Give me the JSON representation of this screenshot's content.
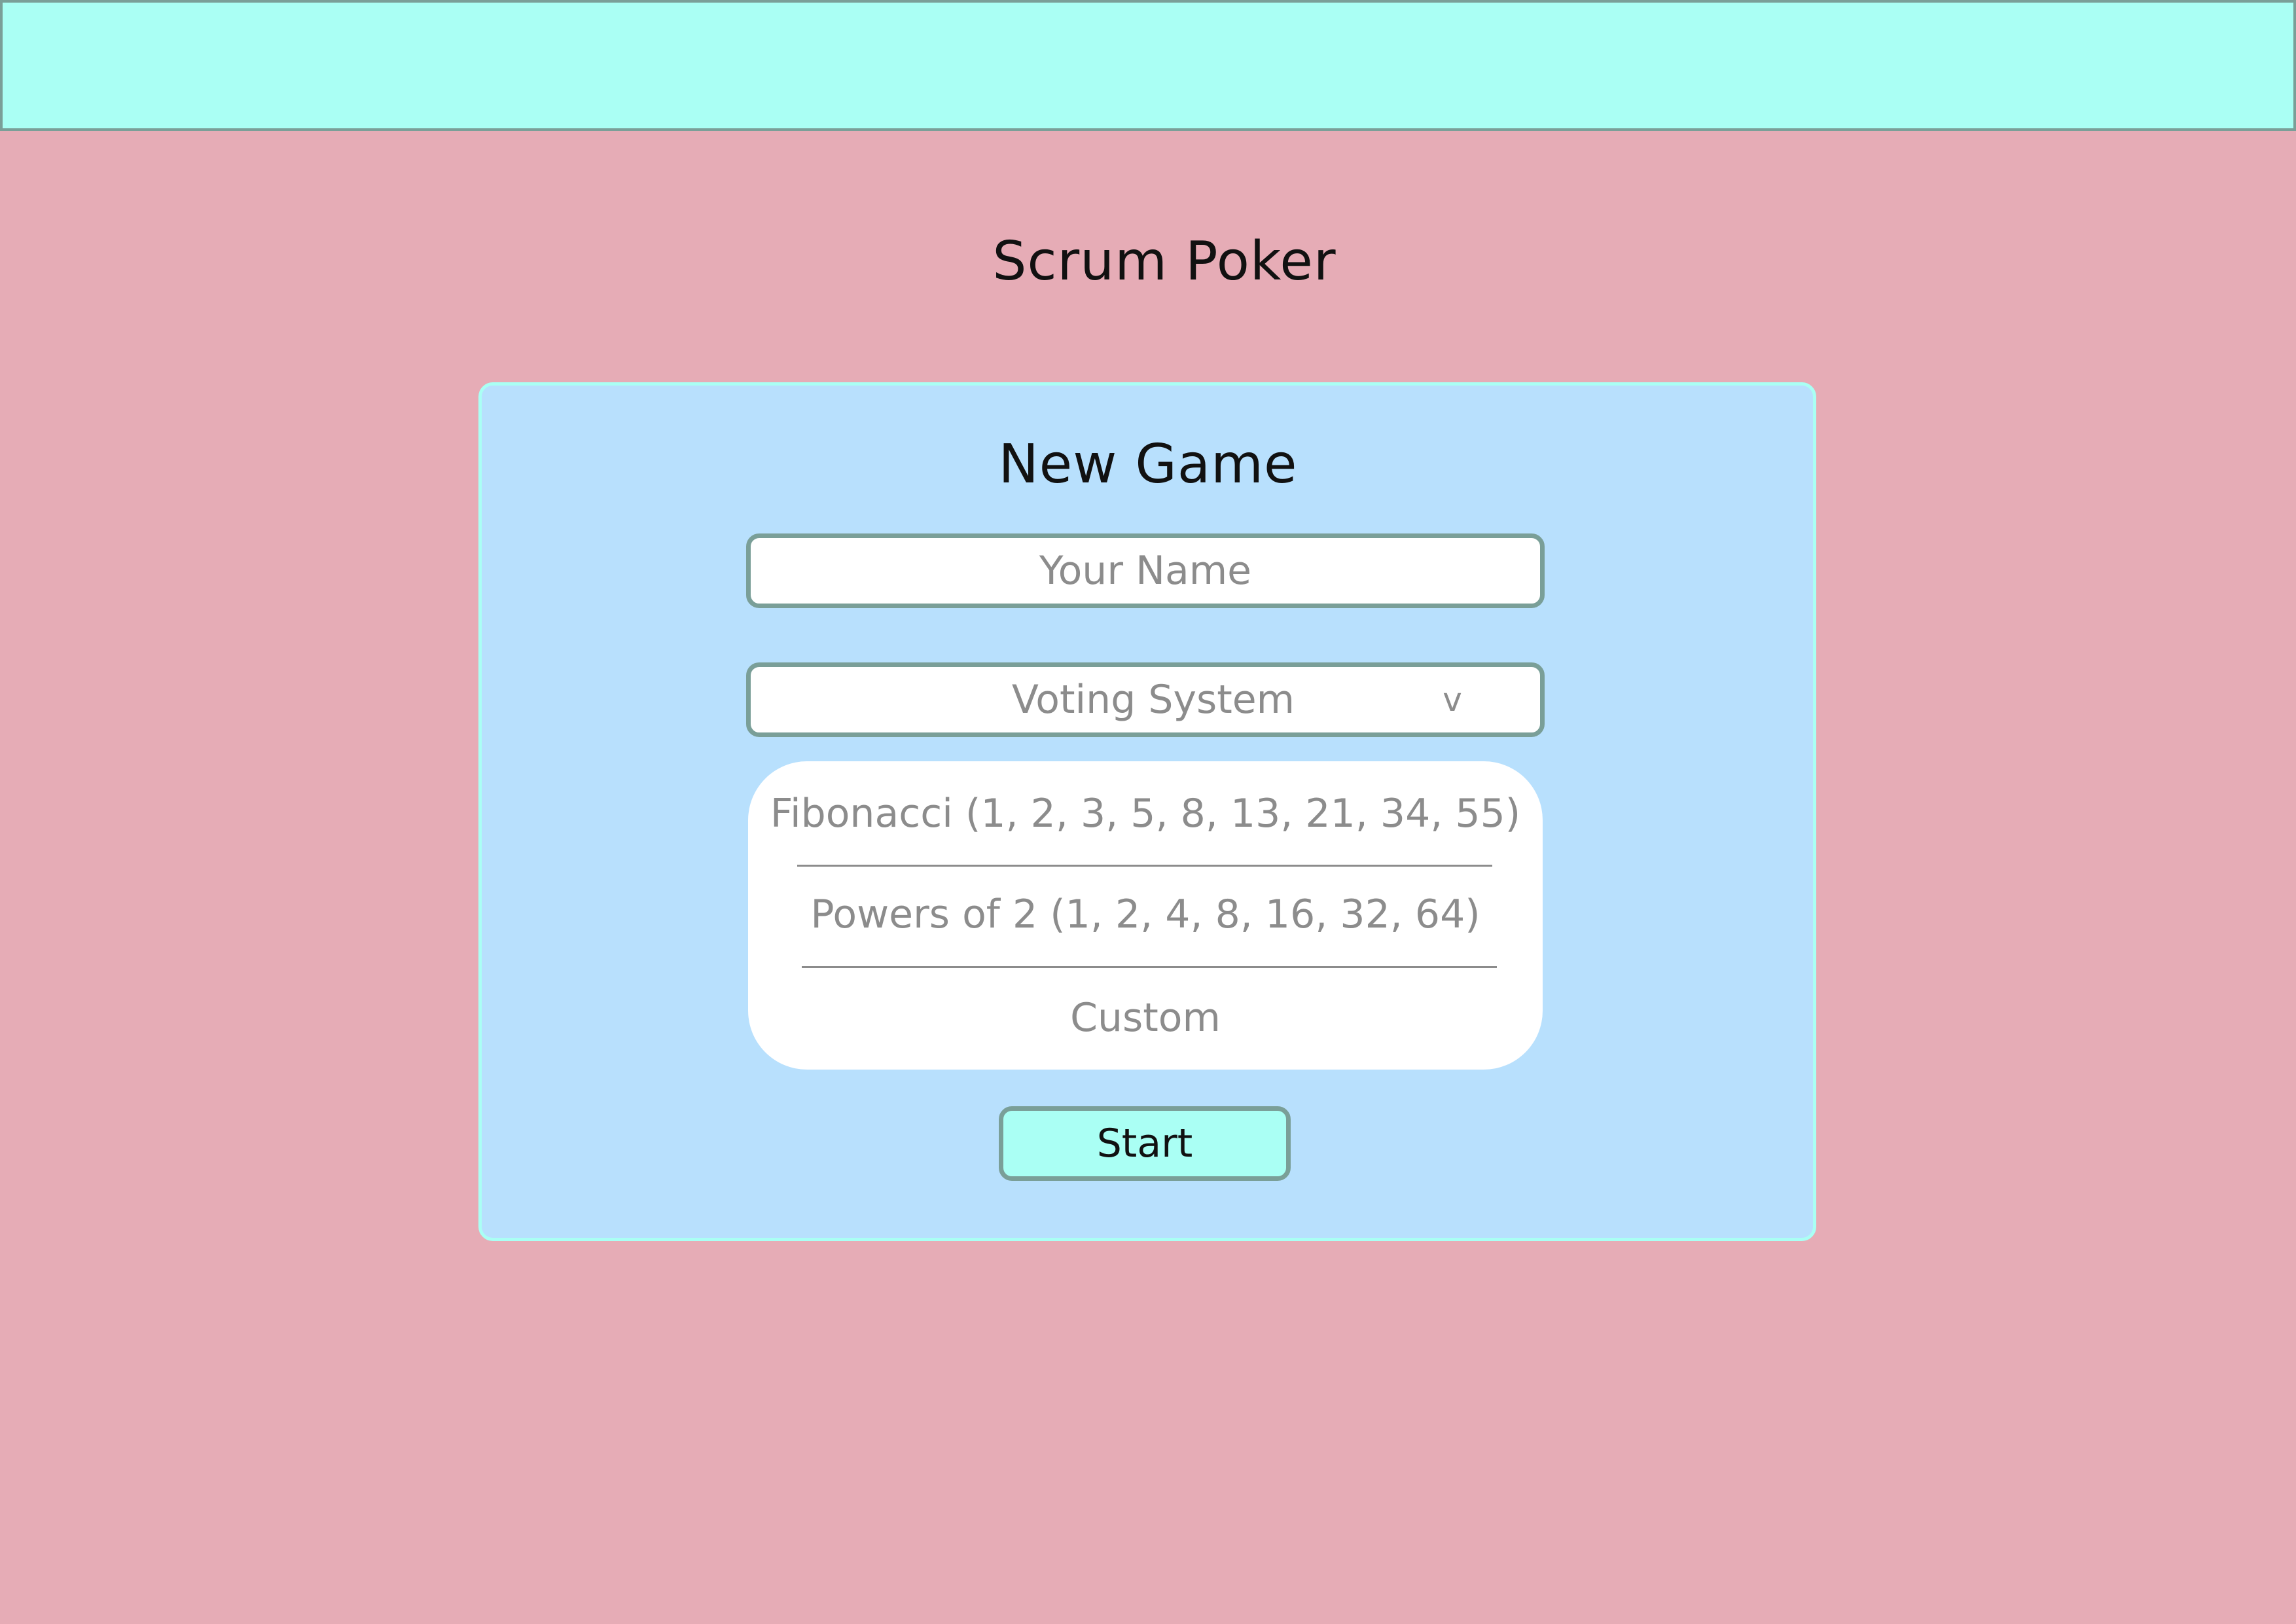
{
  "header": {
    "title": "Scrum Poker"
  },
  "new_game": {
    "title": "New Game",
    "name_input": {
      "placeholder": "Your Name",
      "value": ""
    },
    "voting_system": {
      "placeholder": "Voting System",
      "chevron": "v",
      "icon": "chevron-down-icon",
      "options": [
        "Fibonacci (1, 2, 3, 5, 8, 13, 21, 34, 55)",
        "Powers of 2 (1, 2, 4, 8, 16, 32, 64)",
        "Custom"
      ]
    },
    "start_label": "Start"
  },
  "colors": {
    "background": "#e6acb6",
    "topbar": "#aafff4",
    "card": "#b8e0fd",
    "border": "#7a9f98",
    "placeholder_text": "#8c8c8c",
    "button": "#aafff4"
  }
}
